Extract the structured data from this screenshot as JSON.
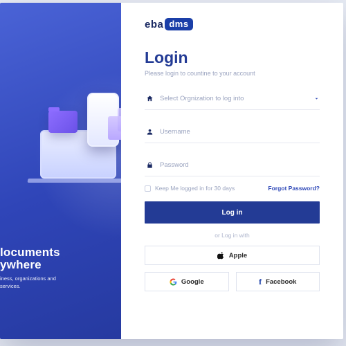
{
  "brand": {
    "part1": "eba",
    "part2": "dms"
  },
  "hero": {
    "headline_l1": "locuments",
    "headline_l2": "ywhere",
    "sub_l1": "iness, organizations and",
    "sub_l2": "services."
  },
  "login": {
    "title": "Login",
    "subtitle": "Please login to countine to your account",
    "org_placeholder": "Select Orgnization to log into",
    "username_placeholder": "Username",
    "password_placeholder": "Password",
    "remember_label": "Keep Me logged in for 30 days",
    "forgot_label": "Forgot Password?",
    "submit_label": "Log in",
    "divider_label": "or Log in with",
    "apple_label": "Apple",
    "google_label": "Google",
    "facebook_label": "Facebook"
  },
  "colors": {
    "primary": "#233b95",
    "accent": "#2f49b8"
  }
}
